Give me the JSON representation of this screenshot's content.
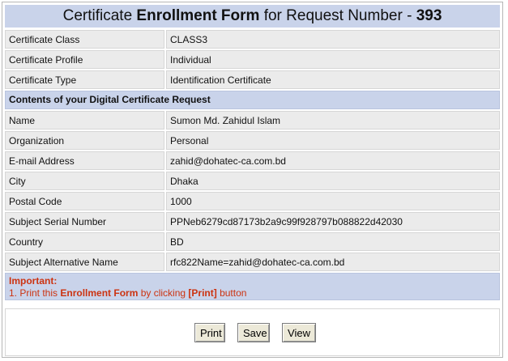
{
  "title": {
    "prefix": "Certificate ",
    "bold_word": "Enrollment Form",
    "middle": " for Request Number - ",
    "request_number": "393"
  },
  "certificate_info": [
    {
      "label": "Certificate Class",
      "value": "CLASS3"
    },
    {
      "label": "Certificate Profile",
      "value": "Individual"
    },
    {
      "label": "Certificate Type",
      "value": "Identification Certificate"
    }
  ],
  "section_heading": "Contents of your Digital Certificate Request",
  "request_fields": [
    {
      "label": "Name",
      "value": "Sumon Md. Zahidul Islam"
    },
    {
      "label": "Organization",
      "value": "Personal"
    },
    {
      "label": "E-mail Address",
      "value": "zahid@dohatec-ca.com.bd"
    },
    {
      "label": "City",
      "value": "Dhaka"
    },
    {
      "label": "Postal Code",
      "value": "1000"
    },
    {
      "label": "Subject Serial Number",
      "value": "PPNeb6279cd87173b2a9c99f928797b088822d42030"
    },
    {
      "label": "Country",
      "value": "BD"
    },
    {
      "label": "Subject Alternative Name",
      "value": "rfc822Name=zahid@dohatec-ca.com.bd"
    }
  ],
  "important": {
    "title": "Important:",
    "line_start": "1. Print this ",
    "line_bold1": "Enrollment Form",
    "line_mid": " by clicking ",
    "line_bold2": "[Print]",
    "line_end": " button"
  },
  "buttons": {
    "print": "Print",
    "save": "Save",
    "view": "View"
  },
  "colors": {
    "header_bg": "#c9d3ea",
    "row_bg": "#ebebeb",
    "important_text": "#cc3311"
  }
}
